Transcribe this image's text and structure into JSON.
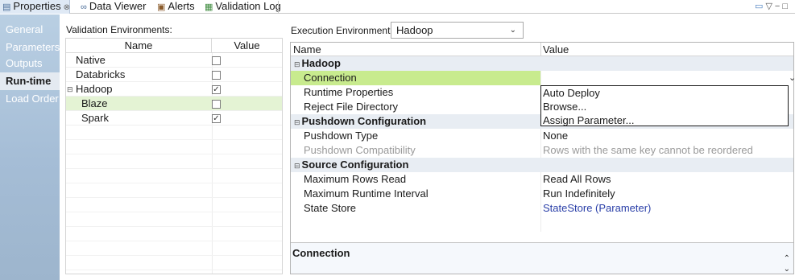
{
  "tabs": [
    {
      "label": "Properties",
      "icon": "properties-icon",
      "active": true
    },
    {
      "label": "Data Viewer",
      "icon": "data-viewer-icon"
    },
    {
      "label": "Alerts",
      "icon": "alerts-icon"
    },
    {
      "label": "Validation Log",
      "icon": "validation-log-icon"
    }
  ],
  "nav": {
    "items": [
      {
        "label": "General"
      },
      {
        "label": "Parameters"
      },
      {
        "label": "Outputs"
      },
      {
        "label": "Run-time",
        "active": true
      },
      {
        "label": "Load Order"
      }
    ]
  },
  "validation": {
    "label": "Validation Environments:",
    "col_name": "Name",
    "col_value": "Value",
    "rows": [
      {
        "name": "Native",
        "checked": false
      },
      {
        "name": "Databricks",
        "checked": false
      },
      {
        "name": "Hadoop",
        "checked": true,
        "expanded": true
      },
      {
        "name": "Blaze",
        "checked": false,
        "selected": true
      },
      {
        "name": "Spark",
        "checked": true
      }
    ]
  },
  "execution": {
    "label": "Execution Environment:",
    "value": "Hadoop"
  },
  "properties": {
    "col_name": "Name",
    "col_value": "Value",
    "rows": [
      {
        "name": "Hadoop",
        "group": true
      },
      {
        "name": "Connection",
        "value": ""
      },
      {
        "name": "Runtime Properties",
        "value": ""
      },
      {
        "name": "Reject File Directory",
        "value": ""
      },
      {
        "name": "Pushdown Configuration",
        "group": true
      },
      {
        "name": "Pushdown Type",
        "value": "None"
      },
      {
        "name": "Pushdown Compatibility",
        "value": "Rows with the same key cannot be reordered",
        "dim": true
      },
      {
        "name": "Source Configuration",
        "group": true
      },
      {
        "name": "Maximum Rows Read",
        "value": "Read All Rows"
      },
      {
        "name": "Maximum Runtime Interval",
        "value": "Run Indefinitely"
      },
      {
        "name": "State Store",
        "value": "StateStore (Parameter)",
        "link": true
      }
    ],
    "dropdown_options": [
      "Auto Deploy",
      "Browse...",
      "Assign Parameter..."
    ]
  },
  "description": {
    "title": "Connection"
  },
  "colors": {
    "nav_bg": "#a5bdd6",
    "selected_row": "#e4f3d4",
    "connection_highlight": "#c8eb8e",
    "group_row": "#e8edf3",
    "link": "#2a3fa8"
  }
}
